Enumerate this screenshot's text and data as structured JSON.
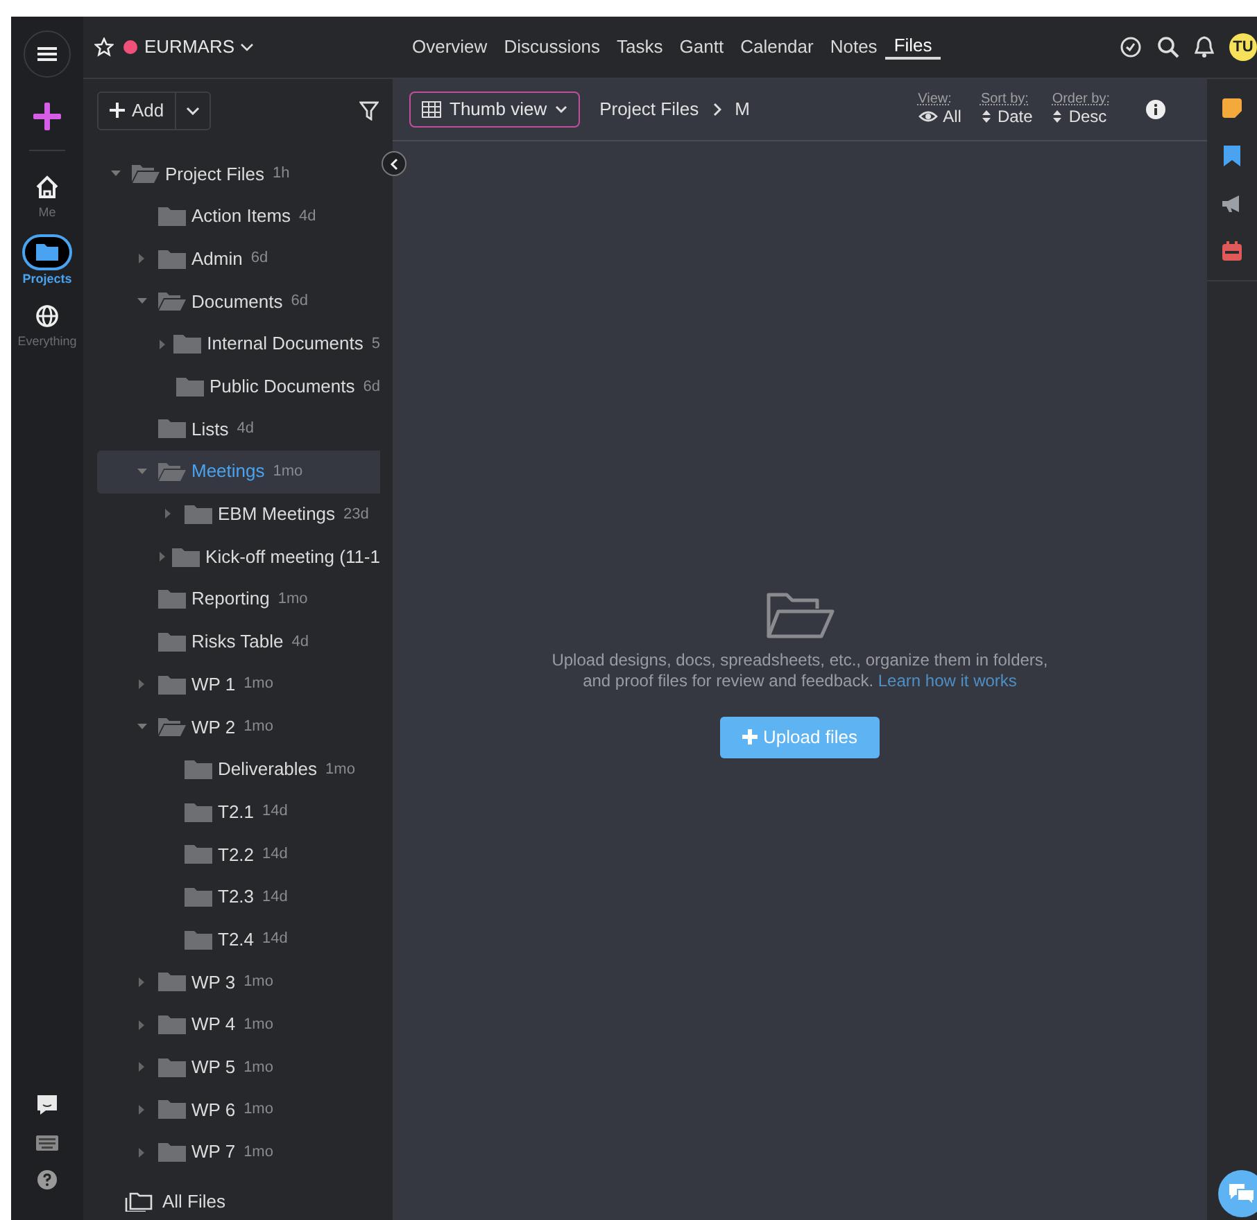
{
  "rail": {
    "items": [
      {
        "kind": "home",
        "label": "Me",
        "selected": false
      },
      {
        "kind": "folder",
        "label": "Projects",
        "selected": true
      },
      {
        "kind": "globe",
        "label": "Everything",
        "selected": false
      }
    ]
  },
  "project": {
    "name": "EURMARS",
    "color": "#f0507a"
  },
  "tabs": [
    {
      "label": "Overview",
      "selected": false
    },
    {
      "label": "Discussions",
      "selected": false
    },
    {
      "label": "Tasks",
      "selected": false
    },
    {
      "label": "Gantt",
      "selected": false
    },
    {
      "label": "Calendar",
      "selected": false
    },
    {
      "label": "Notes",
      "selected": false
    },
    {
      "label": "Files",
      "selected": true
    }
  ],
  "user": {
    "initials": "TU"
  },
  "tree_toolbar": {
    "add_label": "Add"
  },
  "tree": [
    {
      "name": "Project Files",
      "age": "1h",
      "expanded": true,
      "selected": false,
      "children": [
        {
          "name": "Action Items",
          "age": "4d",
          "selected": false
        },
        {
          "name": "Admin",
          "age": "6d",
          "expanded": false,
          "selected": false
        },
        {
          "name": "Documents",
          "age": "6d",
          "expanded": true,
          "selected": false,
          "children": [
            {
              "name": "Internal Documents",
              "age": "5",
              "expanded": false,
              "selected": false
            },
            {
              "name": "Public Documents",
              "age": "6d",
              "selected": false
            }
          ]
        },
        {
          "name": "Lists",
          "age": "4d",
          "selected": false
        },
        {
          "name": "Meetings",
          "age": "1mo",
          "expanded": true,
          "selected": true,
          "children": [
            {
              "name": "EBM Meetings",
              "age": "23d",
              "expanded": false,
              "selected": false
            },
            {
              "name": "Kick-off meeting (11-1",
              "expanded": false,
              "selected": false
            }
          ]
        },
        {
          "name": "Reporting",
          "age": "1mo",
          "selected": false
        },
        {
          "name": "Risks Table",
          "age": "4d",
          "selected": false
        },
        {
          "name": "WP 1",
          "age": "1mo",
          "expanded": false,
          "selected": false
        },
        {
          "name": "WP 2",
          "age": "1mo",
          "expanded": true,
          "selected": false,
          "children": [
            {
              "name": "Deliverables",
              "age": "1mo",
              "selected": false
            },
            {
              "name": "T2.1",
              "age": "14d",
              "selected": false
            },
            {
              "name": "T2.2",
              "age": "14d",
              "selected": false
            },
            {
              "name": "T2.3",
              "age": "14d",
              "selected": false
            },
            {
              "name": "T2.4",
              "age": "14d",
              "selected": false
            }
          ]
        },
        {
          "name": "WP 3",
          "age": "1mo",
          "expanded": false,
          "selected": false
        },
        {
          "name": "WP 4",
          "age": "1mo",
          "expanded": false,
          "selected": false
        },
        {
          "name": "WP 5",
          "age": "1mo",
          "expanded": false,
          "selected": false
        },
        {
          "name": "WP 6",
          "age": "1mo",
          "expanded": false,
          "selected": false
        },
        {
          "name": "WP 7",
          "age": "1mo",
          "expanded": false,
          "selected": false
        }
      ]
    }
  ],
  "all_files": {
    "label": "All Files"
  },
  "files_toolbar": {
    "view_mode": "Thumb view",
    "breadcrumb": [
      "Project Files",
      "M"
    ],
    "options": [
      {
        "kind": "view",
        "label": "View:",
        "value": "All"
      },
      {
        "kind": "sort",
        "label": "Sort by:",
        "value": "Date"
      },
      {
        "kind": "order",
        "label": "Order by:",
        "value": "Desc"
      }
    ]
  },
  "empty_state": {
    "message": "Upload designs, docs, spreadsheets, etc., organize them in folders, and proof files for review and feedback.",
    "link": "Learn how it works",
    "button": "Upload files"
  }
}
